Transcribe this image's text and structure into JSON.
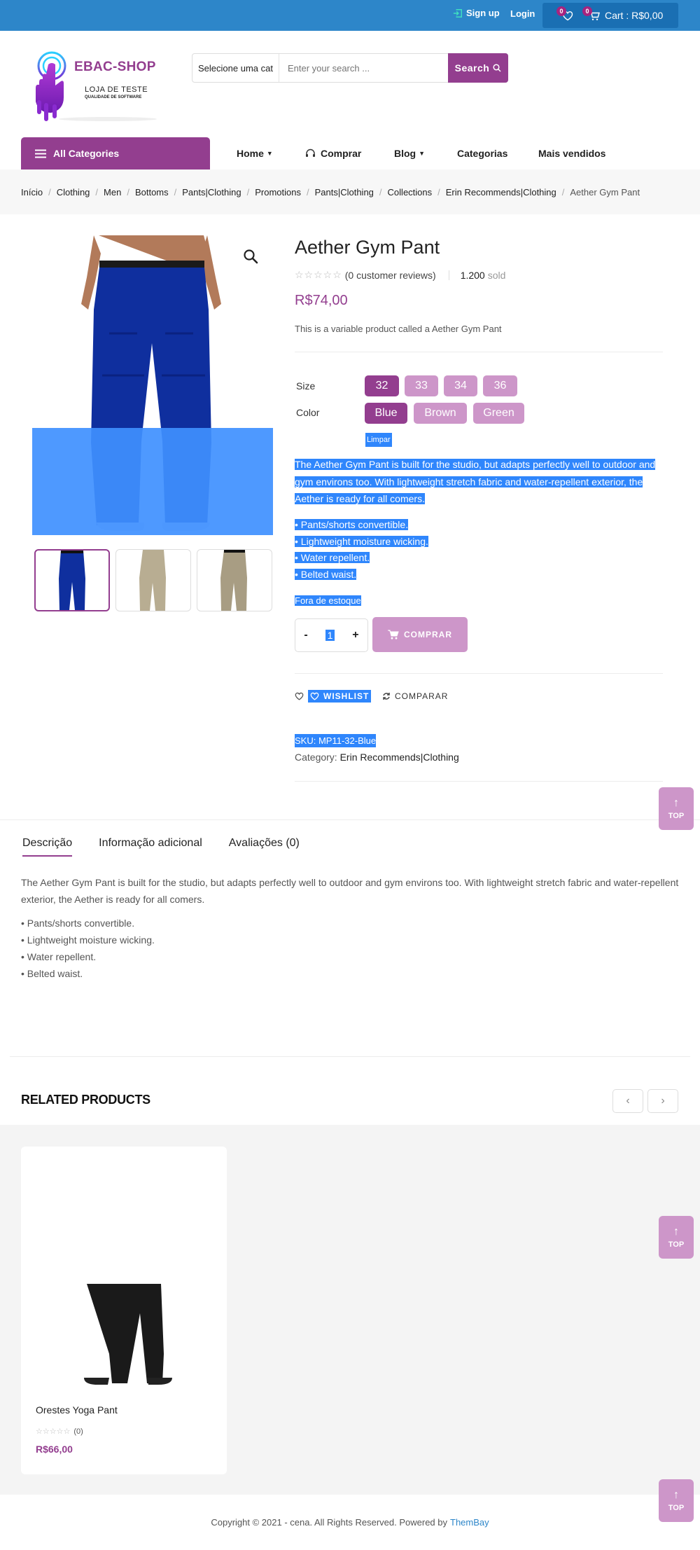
{
  "topbar": {
    "signup": "Sign up",
    "login": "Login",
    "wishlist_count": "0",
    "cart_count": "0",
    "cart_label": "Cart : R$0,00"
  },
  "logo": {
    "brand": "EBAC-SHOP",
    "tagline1": "LOJA DE TESTE",
    "tagline2": "QUALIDADE DE SOFTWARE"
  },
  "search": {
    "category": "Selecione uma cat",
    "placeholder": "Enter your search ...",
    "button": "Search"
  },
  "nav": {
    "all_categories": "All Categories",
    "items": [
      "Home",
      "Comprar",
      "Blog",
      "Categorias",
      "Mais vendidos"
    ]
  },
  "breadcrumb": [
    "Início",
    "Clothing",
    "Men",
    "Bottoms",
    "Pants|Clothing",
    "Promotions",
    "Pants|Clothing",
    "Collections",
    "Erin Recommends|Clothing",
    "Aether Gym Pant"
  ],
  "product": {
    "title": "Aether Gym Pant",
    "reviews": "(0 customer reviews)",
    "sold_count": "1.200",
    "sold_label": "sold",
    "price": "R$74,00",
    "short_desc": "This is a variable product called a Aether Gym Pant",
    "size_label": "Size",
    "sizes": [
      "32",
      "33",
      "34",
      "36"
    ],
    "color_label": "Color",
    "colors": [
      "Blue",
      "Brown",
      "Green"
    ],
    "clear": "Limpar",
    "long_desc": "The Aether Gym Pant is built for the studio, but adapts perfectly well to outdoor and gym environs too. With lightweight stretch fabric and water-repellent exterior, the Aether is ready for all comers.",
    "features": [
      "• Pants/shorts convertible.",
      "• Lightweight moisture wicking.",
      "• Water repellent.",
      "• Belted waist."
    ],
    "stock": "Fora de estoque",
    "qty_minus": "-",
    "qty_value": "1",
    "qty_plus": "+",
    "buy": "COMPRAR",
    "wishlist": "WISHLIST",
    "compare": "COMPARAR",
    "sku": "SKU: MP11-32-Blue",
    "category_label": "Category:",
    "category_value": "Erin Recommends|Clothing"
  },
  "tabs": [
    "Descrição",
    "Informação adicional",
    "Avaliações (0)"
  ],
  "description": {
    "text": "The Aether Gym Pant is built for the studio, but adapts perfectly well to outdoor and gym environs too. With lightweight stretch fabric and water-repellent exterior, the Aether is ready for all comers.",
    "features": [
      "• Pants/shorts convertible.",
      "• Lightweight moisture wicking.",
      "• Water repellent.",
      "• Belted waist."
    ]
  },
  "related": {
    "title": "RELATED PRODUCTS",
    "prev": "‹",
    "next": "›",
    "products": [
      {
        "name": "Orestes Yoga Pant",
        "reviews": "(0)",
        "price": "R$66,00"
      }
    ]
  },
  "footer": {
    "text": "Copyright © 2021 - cena. All Rights Reserved. Powered by",
    "link": "ThemBay"
  },
  "top_button": "TOP",
  "colors": {
    "brand": "#933e8f",
    "brand_light": "#cd96c9",
    "topbar": "#2d86c9",
    "selection": "#2f86fc"
  }
}
